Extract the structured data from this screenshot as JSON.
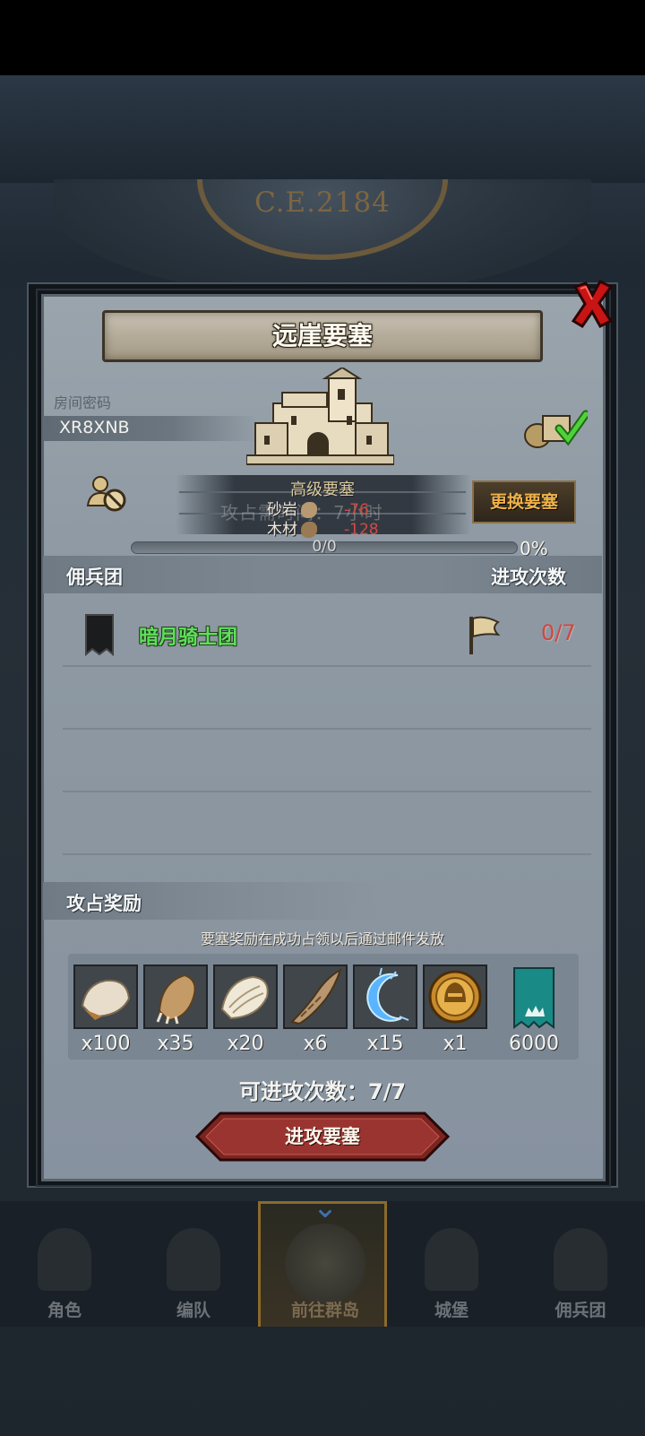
{
  "era_label": "C.E.2184",
  "dialog": {
    "title": "远崖要塞",
    "room_code_label": "房间密码",
    "room_code": "XR8XNB",
    "fort_level": "高级要塞",
    "ghost_text": "攻占需时间：7小时",
    "resources": [
      {
        "name": "砂岩",
        "cost": "-76",
        "icon": "stone-icon",
        "color": "#b89a72"
      },
      {
        "name": "木材",
        "cost": "-128",
        "icon": "wood-icon",
        "color": "#9a7a52"
      }
    ],
    "change_button": "更换要塞",
    "progress": {
      "text": "0/0",
      "percent_label": "0%",
      "fraction": 0
    },
    "mercenary_header": "佣兵团",
    "attack_count_header": "进攻次数",
    "mercenary": {
      "name": "暗月骑士团",
      "attack_count": "0/7",
      "name_color": "#5ee05a"
    },
    "reward_header": "攻占奖励",
    "reward_note": "要塞奖励在成功占领以后通过邮件发放",
    "rewards": [
      {
        "icon": "fur-pelt-icon",
        "qty": "x100"
      },
      {
        "icon": "claw-icon",
        "qty": "x35"
      },
      {
        "icon": "scale-icon",
        "qty": "x20"
      },
      {
        "icon": "horn-icon",
        "qty": "x6"
      },
      {
        "icon": "blue-crescent-icon",
        "qty": "x15"
      },
      {
        "icon": "gold-helmet-coin-icon",
        "qty": "x1"
      },
      {
        "icon": "guild-token-icon",
        "qty": "6000"
      }
    ],
    "remaining_attacks": "可进攻次数：7/7",
    "attack_button": "进攻要塞"
  },
  "bottom_nav": [
    {
      "label": "角色",
      "icon": "knight-icon"
    },
    {
      "label": "编队",
      "icon": "formation-icon"
    },
    {
      "label": "前往群岛",
      "icon": "island-compass-icon",
      "active": true
    },
    {
      "label": "城堡",
      "icon": "castle-icon"
    },
    {
      "label": "佣兵团",
      "icon": "ship-icon"
    }
  ]
}
